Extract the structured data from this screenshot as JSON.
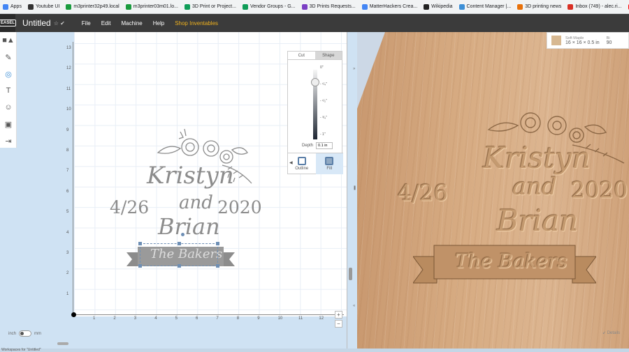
{
  "bookmarks": [
    {
      "label": "Apps",
      "color": "#4285f4"
    },
    {
      "label": "Youtube UI",
      "color": "#333333"
    },
    {
      "label": "m3printer32p49.local",
      "color": "#1a9c3e"
    },
    {
      "label": "m3printer03m01.lo...",
      "color": "#1a9c3e"
    },
    {
      "label": "3D Print or Project...",
      "color": "#0f9d58"
    },
    {
      "label": "Vendor Groups - G...",
      "color": "#0f9d58"
    },
    {
      "label": "3D Prints Requests...",
      "color": "#7b3fc4"
    },
    {
      "label": "MatterHackers Crea...",
      "color": "#4285f4"
    },
    {
      "label": "Wikipedia",
      "color": "#222222"
    },
    {
      "label": "Content Manager |...",
      "color": "#3d8fd6"
    },
    {
      "label": "3D printing news",
      "color": "#e8710a"
    },
    {
      "label": "Inbox (749) - alec.ri...",
      "color": "#d93025"
    },
    {
      "label": "YouTube",
      "color": "#ff0000"
    }
  ],
  "app": {
    "logo": "EASEL",
    "title": "Untitled",
    "title_icons": "☆ ✔",
    "menu": [
      "File",
      "Edit",
      "Machine",
      "Help"
    ],
    "shop": "Shop Inventables"
  },
  "toolbar": {
    "tools": [
      {
        "name": "shapes-icon",
        "glyph": "■▲"
      },
      {
        "name": "pen-icon",
        "glyph": "✎"
      },
      {
        "name": "target-icon",
        "glyph": "◎"
      },
      {
        "name": "text-icon",
        "glyph": "T"
      },
      {
        "name": "icons-icon",
        "glyph": "☺"
      },
      {
        "name": "apps-icon",
        "glyph": "▣"
      },
      {
        "name": "import-icon",
        "glyph": "⇥"
      }
    ]
  },
  "canvas": {
    "y_ticks": [
      "13",
      "12",
      "11",
      "10",
      "9",
      "8",
      "7",
      "6",
      "5",
      "4",
      "3",
      "2",
      "1"
    ],
    "x_ticks": [
      "1",
      "2",
      "3",
      "4",
      "5",
      "6",
      "7",
      "8",
      "9",
      "10",
      "11",
      "12"
    ],
    "design": {
      "line1": "Kristyn",
      "line2": "and",
      "date_left": "4/26",
      "date_right": "2020",
      "line3": "Brian",
      "ribbon": "The Bakers"
    }
  },
  "cut_panel": {
    "tab_cut": "Cut",
    "tab_shape": "Shape",
    "depth_ticks": [
      "0\"",
      "- ¹/₄\"",
      "- ¹/₂\"",
      "- ³/₄\"",
      "- 1\""
    ],
    "depth_label": "Depth",
    "depth_value": "0.1 in",
    "outline_label": "Outline",
    "fill_label": "Fill"
  },
  "preview": {
    "material_name": "Soft Maple",
    "material_size": "16 × 16 × 0.5 in",
    "extra_label": "Bi",
    "extra_value": "90",
    "details": "↙ Details"
  },
  "bottom": {
    "unit_in": "inch",
    "unit_mm": "mm",
    "workspace": "Workspaces for \"Untitled\""
  }
}
